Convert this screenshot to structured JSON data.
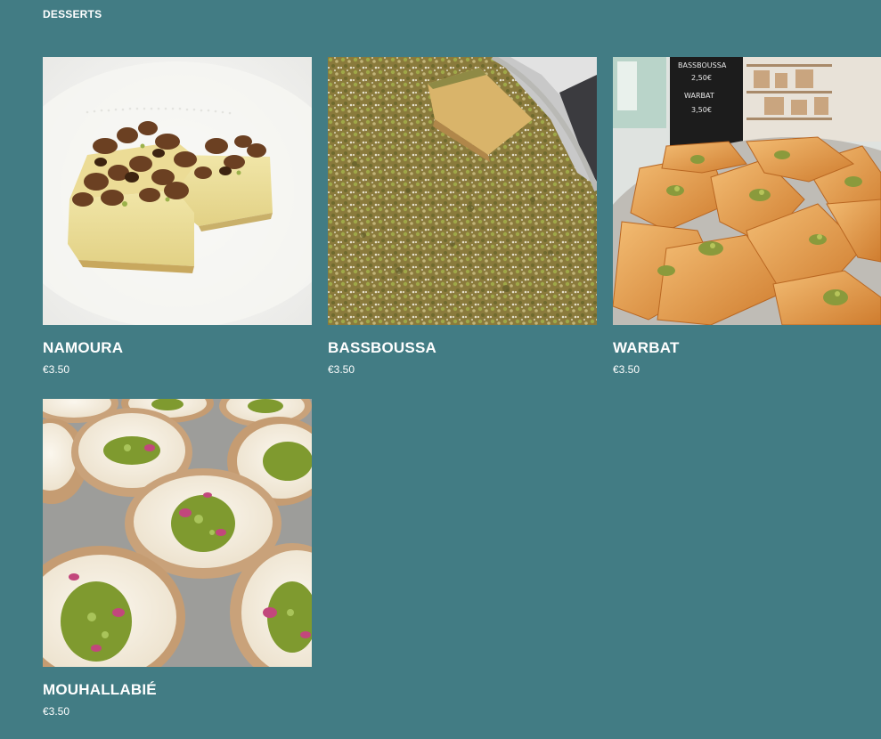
{
  "section": {
    "title": "DESSERTS"
  },
  "products": [
    {
      "name": "NAMOURA",
      "price": "€3.50"
    },
    {
      "name": "BASSBOUSSA",
      "price": "€3.50"
    },
    {
      "name": "WARBAT",
      "price": "€3.50"
    },
    {
      "name": "MOUHALLABIÉ",
      "price": "€3.50"
    }
  ],
  "warbat_sign": {
    "line1": "BASSBOUSSA",
    "line2": "2,50€",
    "line3": "WARBAT",
    "line4": "3,50€"
  },
  "colors": {
    "background": "#427c84",
    "text": "#ffffff"
  }
}
